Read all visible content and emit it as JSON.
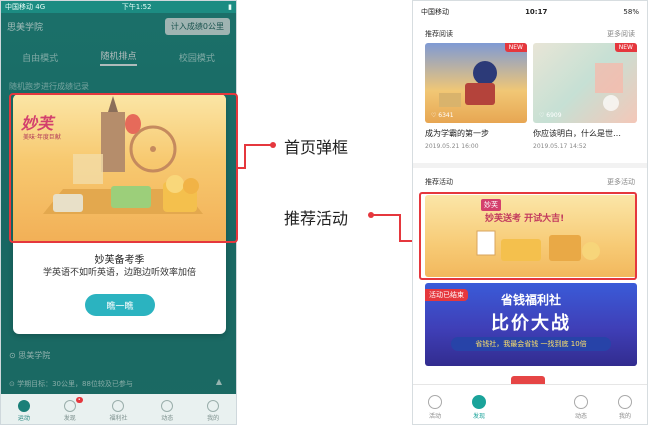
{
  "left_phone": {
    "status": {
      "carrier": "中国移动",
      "network": "4G",
      "time": "下午1:52"
    },
    "header": {
      "title": "思美学院",
      "add_button": "计入成绩0公里"
    },
    "tabs": [
      {
        "label": "自由模式"
      },
      {
        "label": "随机排点"
      },
      {
        "label": "校园模式"
      }
    ],
    "subtitle": "随机跑步进行成绩记录",
    "popup": {
      "brand": "妙芙",
      "brand_sub": "美味·年度巨献",
      "title": "妙芙备考季",
      "desc": "学英语不如听英语，边跑边听效率加倍",
      "button": "瞧一瞧"
    },
    "school_label": "思美学院",
    "term_stats": "学期目标：30公里，88位较及已参与",
    "tabbar": [
      {
        "label": "运动"
      },
      {
        "label": "发现"
      },
      {
        "label": "福利社"
      },
      {
        "label": "动态"
      },
      {
        "label": "我的"
      }
    ]
  },
  "annotations": {
    "popup_label": "首页弹框",
    "activity_label": "推荐活动"
  },
  "right_phone": {
    "status": {
      "carrier": "中国移动",
      "time": "10:17",
      "battery": "58%"
    },
    "reading": {
      "header": "推荐阅读",
      "more": "更多阅读",
      "cards": [
        {
          "title": "成为学霸的第一步",
          "date": "2019.05.21 16:00",
          "metric": "6341",
          "badge": "NEW"
        },
        {
          "title": "你应该明白，什么是世…",
          "date": "2019.05.17 14:52",
          "metric": "6909",
          "badge": "NEW"
        }
      ]
    },
    "activity": {
      "header": "推荐活动",
      "more": "更多活动",
      "banner1": {
        "logo": "妙芙",
        "text": "妙芙送考 开试大吉!"
      },
      "banner2": {
        "tag": "活动已结束",
        "title": "省钱福利社",
        "headline": "比价大战",
        "slogan": "省钱社，我最会省钱 一找到底 10倍"
      }
    },
    "tabbar": [
      {
        "label": "活动"
      },
      {
        "label": "发现"
      },
      {
        "label": ""
      },
      {
        "label": "动态"
      },
      {
        "label": "我的"
      }
    ]
  }
}
